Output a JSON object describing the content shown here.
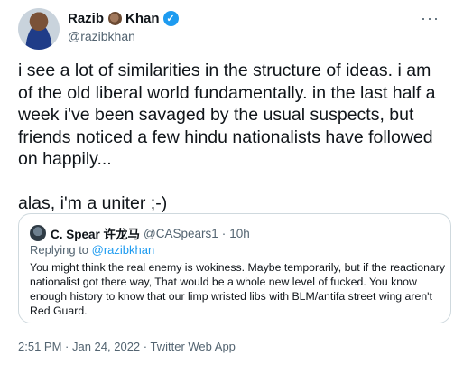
{
  "author": {
    "first_name": "Razib",
    "last_name": "Khan",
    "name_emoji": "coconut-emoji",
    "verified_icon": "verified-badge-icon",
    "handle": "@razibkhan"
  },
  "more_icon": "more-icon",
  "tweet_text": "i see a lot of similarities in the structure of ideas. i am of the old liberal world fundamentally. in the last half a week i've been savaged by the usual suspects, but friends noticed a few hindu nationalists have followed on happily...\n\nalas, i'm a uniter ;-)",
  "quote": {
    "name": "C. Spear 许龙马",
    "handle": "@CASpears1",
    "separator": "·",
    "time": "10h",
    "replying_prefix": "Replying to",
    "replying_to": "@razibkhan",
    "text": "You might think the real enemy is wokiness.  Maybe temporarily, but if the reactionary nationalist got there way, That would be a whole new level of fucked. You know enough history to know that our limp wristed libs with BLM/antifa street wing aren't  Red Guard."
  },
  "footer": {
    "time": "2:51 PM",
    "date": "Jan 24, 2022",
    "source": "Twitter Web App",
    "sep": "·"
  },
  "colors": {
    "accent": "#1d9bf0",
    "secondary_text": "#536471",
    "border": "#cfd9de"
  }
}
